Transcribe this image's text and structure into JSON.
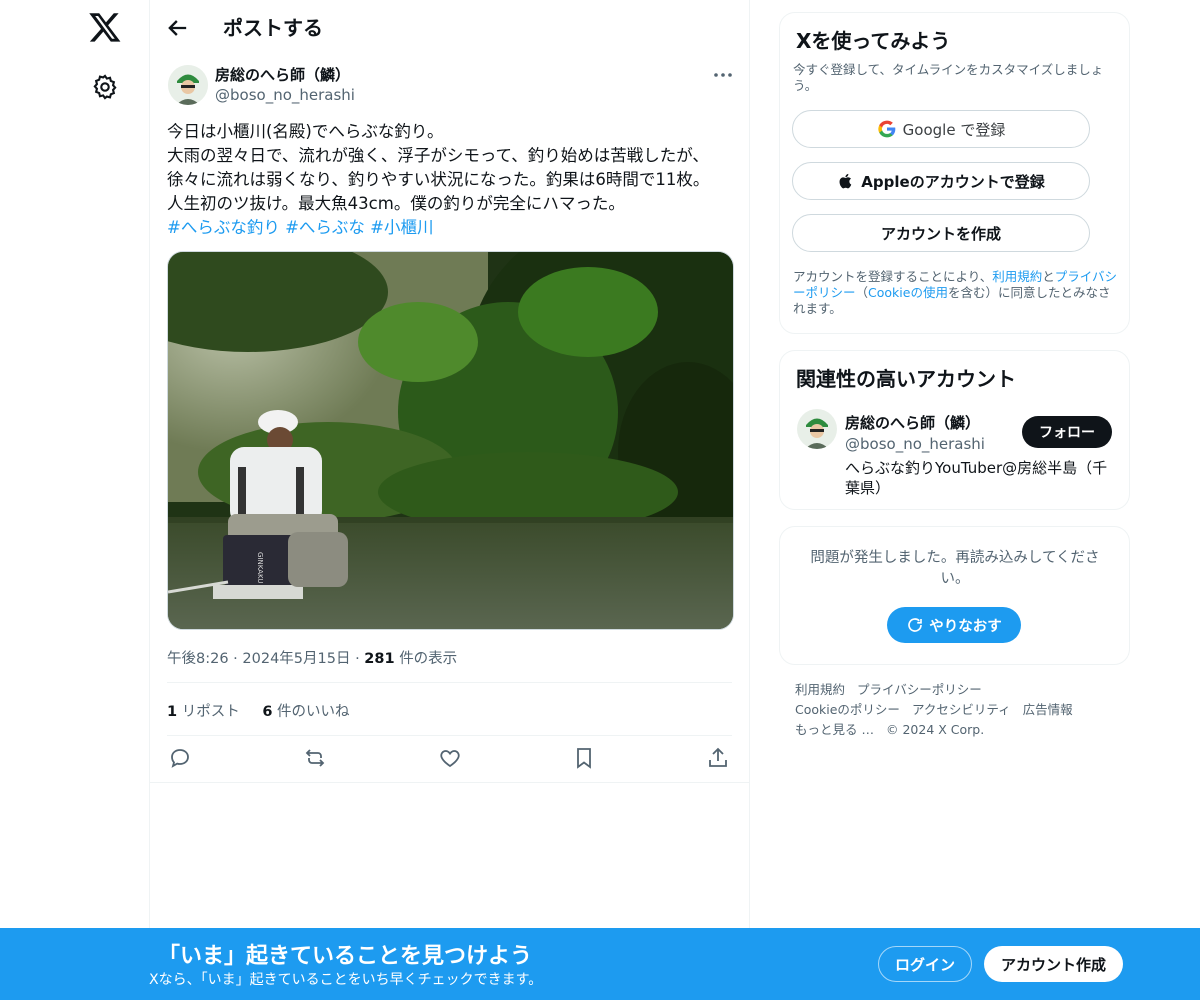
{
  "header": {
    "title": "ポストする"
  },
  "tweet": {
    "author_name": "房総のへら師（鱗）",
    "author_handle": "@boso_no_herashi",
    "text_lines": [
      "今日は小櫃川(名殿)でへらぶな釣り。",
      "大雨の翌々日で、流れが強く、浮子がシモって、釣り始めは苦戦したが、",
      "徐々に流れは弱くなり、釣りやすい状況になった。釣果は6時間で11枚。",
      "人生初のツ抜け。最大魚43cm。僕の釣りが完全にハマった。"
    ],
    "hashtags": [
      "#へらぶな釣り",
      "#へらぶな",
      "#小櫃川"
    ],
    "time": "午後8:26",
    "date": "2024年5月15日",
    "views_count": "281",
    "views_label": "件の表示",
    "reposts_count": "1",
    "reposts_label": "リポスト",
    "likes_count": "6",
    "likes_label": "件のいいね",
    "seat_brand": "GINKAKU"
  },
  "signup_card": {
    "title": "Xを使ってみよう",
    "subtitle": "今すぐ登録して、タイムラインをカスタマイズしましょう。",
    "google_label": "Google で登録",
    "google_brand": "Google",
    "apple_label": "Appleのアカウントで登録",
    "create_label": "アカウントを作成",
    "legal_1": "アカウントを登録することにより、",
    "legal_terms": "利用規約",
    "legal_and": "と",
    "legal_privacy": "プライバシーポリシー",
    "legal_2": "（",
    "legal_cookie": "Cookieの使用",
    "legal_3": "を含む）に同意したとみなされます。"
  },
  "relevant_card": {
    "title": "関連性の高いアカウント",
    "name": "房総のへら師（鱗）",
    "handle": "@boso_no_herashi",
    "bio": "へらぶな釣りYouTuber@房総半島（千葉県）",
    "follow_label": "フォロー"
  },
  "error_card": {
    "message": "問題が発生しました。再読み込みしてください。",
    "retry_label": "やりなおす"
  },
  "footer": {
    "links": [
      "利用規約",
      "プライバシーポリシー",
      "Cookieのポリシー",
      "アクセシビリティ",
      "広告情報",
      "もっと見る …",
      "© 2024 X Corp."
    ]
  },
  "banner": {
    "title": "「いま」起きていることを見つけよう",
    "subtitle": "Xなら、「いま」起きていることをいち早くチェックできます。",
    "login_label": "ログイン",
    "signup_label": "アカウント作成"
  },
  "colors": {
    "accent": "#1d9bf0",
    "text": "#0f1419",
    "muted": "#536471",
    "follow_bg": "#0f1419"
  }
}
